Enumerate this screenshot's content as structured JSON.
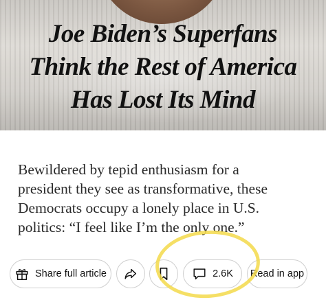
{
  "headline": {
    "lines": [
      "Joe Biden’s Superfans",
      "Think the Rest of America",
      "Has Lost Its Mind"
    ]
  },
  "summary": {
    "lines": [
      "Bewildered by tepid enthusiasm for a",
      "president they see as transformative, these",
      "Democrats occupy a lonely place in U.S.",
      "politics: “I feel like I’m the only one.”"
    ]
  },
  "actions": {
    "share_label": "Share full article",
    "comments_count": "2.6K",
    "read_in_app_label": "Read in app",
    "icons": [
      "gift-icon",
      "forward-arrow-icon",
      "bookmark-icon",
      "comment-icon"
    ]
  },
  "colors": {
    "highlight": "#f3d94a",
    "text": "#121212",
    "pill_border": "#cfcfcf"
  }
}
